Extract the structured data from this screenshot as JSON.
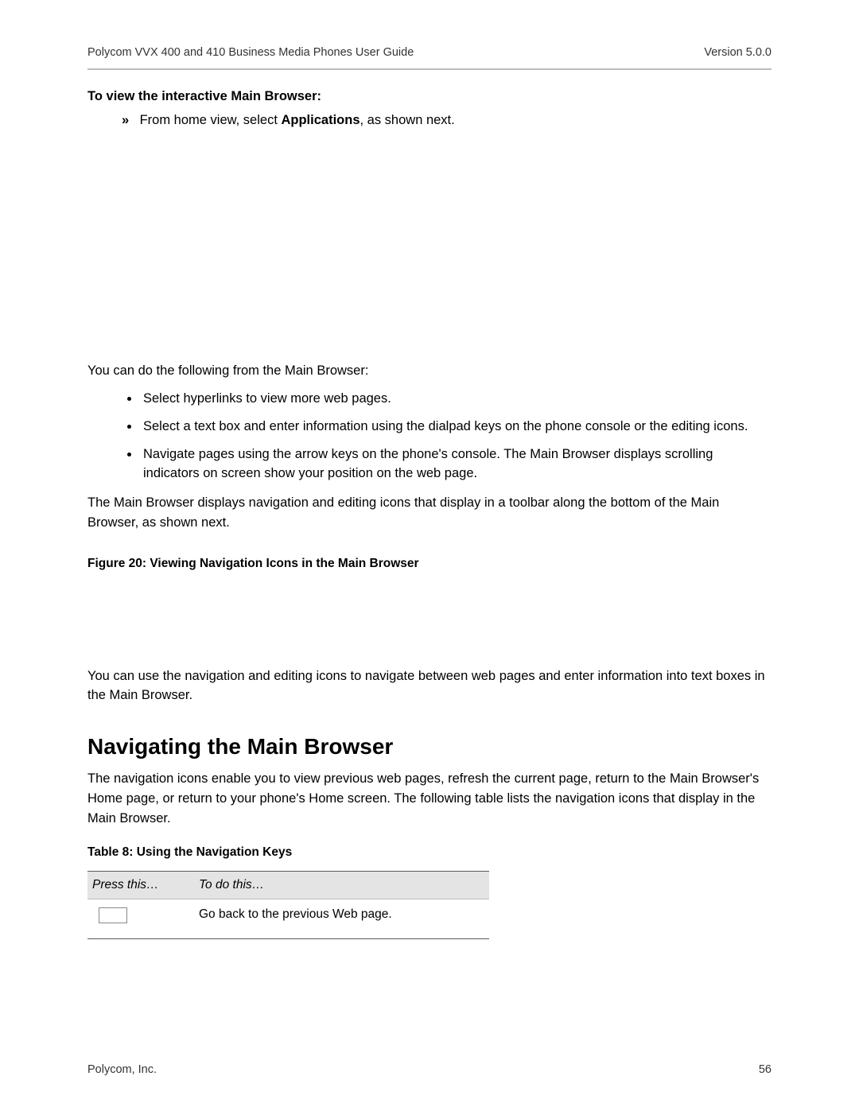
{
  "header": {
    "doc_title": "Polycom VVX 400 and 410 Business Media Phones User Guide",
    "version": "Version 5.0.0"
  },
  "section1": {
    "heading": "To view the interactive Main Browser:",
    "step_marker": "»",
    "step_prefix": "From home view, select ",
    "step_bold": "Applications",
    "step_suffix": ", as shown next."
  },
  "para_intro": "You can do the following from the Main Browser:",
  "bullets": [
    "Select hyperlinks to view more web pages.",
    "Select a text box and enter information using the dialpad keys on the phone console or the editing icons.",
    "Navigate pages using the arrow keys on the phone's console. The Main Browser displays scrolling indicators on screen show your position on the web page."
  ],
  "para_after_bullets": "The Main Browser displays navigation and editing icons that display in a toolbar along the bottom of the Main Browser, as shown next.",
  "figure20_caption": "Figure 20: Viewing Navigation Icons in the Main Browser",
  "para_after_fig": "You can use the navigation and editing icons to navigate between web pages and enter information into text boxes in the Main Browser.",
  "section2": {
    "title": "Navigating the Main Browser",
    "intro": "The navigation icons enable you to view previous web pages, refresh the current page, return to the Main Browser's Home page, or return to your phone's Home screen. The following table lists the navigation icons that display in the Main Browser."
  },
  "table8": {
    "caption": "Table 8: Using the Navigation Keys",
    "col1": "Press this…",
    "col2": "To do this…",
    "row1_action": "Go back to the previous Web page."
  },
  "footer": {
    "company": "Polycom, Inc.",
    "page": "56"
  }
}
